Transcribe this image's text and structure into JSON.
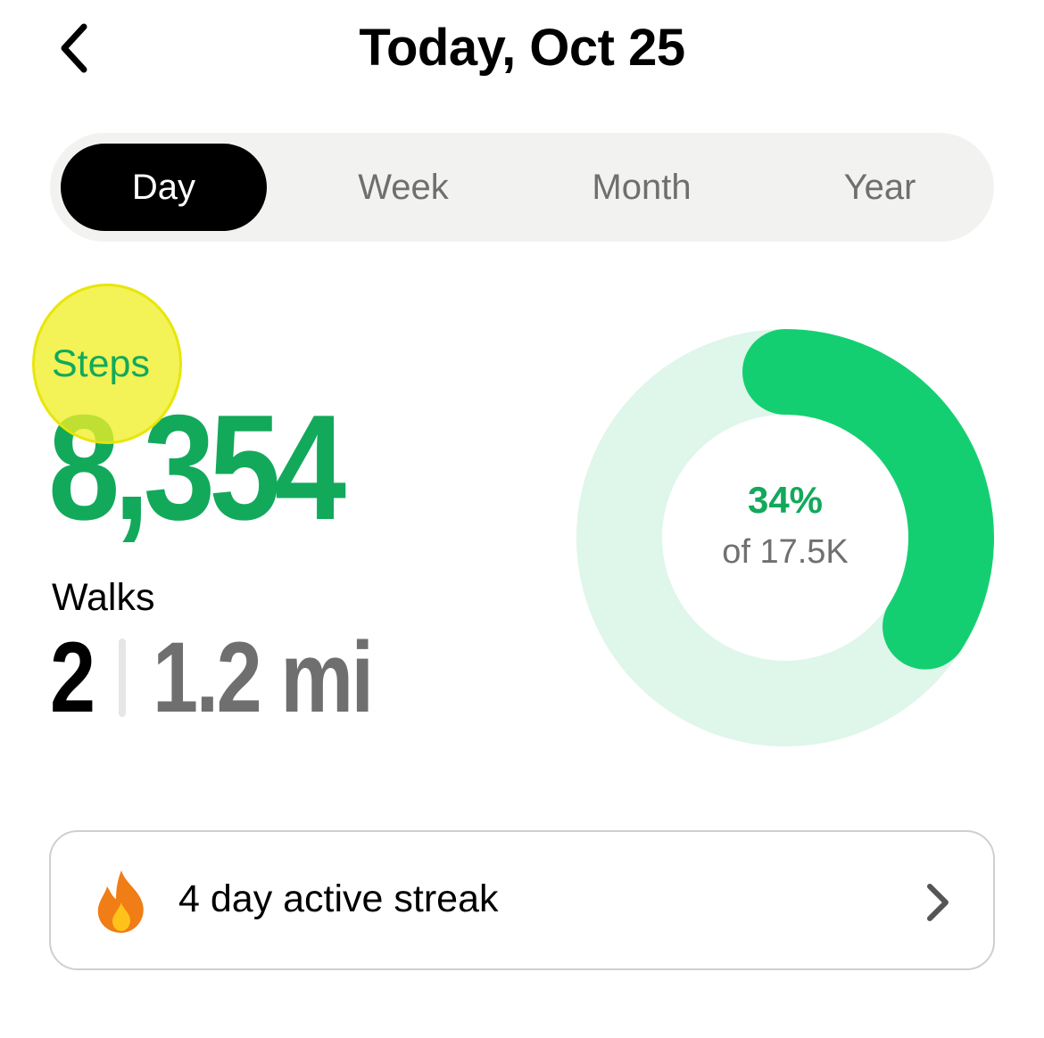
{
  "header": {
    "title": "Today, Oct 25"
  },
  "period_tabs": [
    {
      "label": "Day",
      "active": true
    },
    {
      "label": "Week",
      "active": false
    },
    {
      "label": "Month",
      "active": false
    },
    {
      "label": "Year",
      "active": false
    }
  ],
  "steps": {
    "label": "Steps",
    "value": "8,354"
  },
  "walks": {
    "label": "Walks",
    "count": "2",
    "distance": "1.2 mi"
  },
  "goal_ring": {
    "percent_text": "34%",
    "goal_text": "of 17.5K",
    "progress_fraction": 0.34
  },
  "streak": {
    "text": "4 day active streak"
  },
  "colors": {
    "accent_green": "#12a95b",
    "ring_progress": "#14cf72",
    "ring_track": "#dff6ea",
    "tab_active_bg": "#000000",
    "segment_bg": "#f2f2f0"
  },
  "icons": {
    "back": "chevron-left-icon",
    "streak": "fire-icon",
    "streak_nav": "chevron-right-icon"
  }
}
